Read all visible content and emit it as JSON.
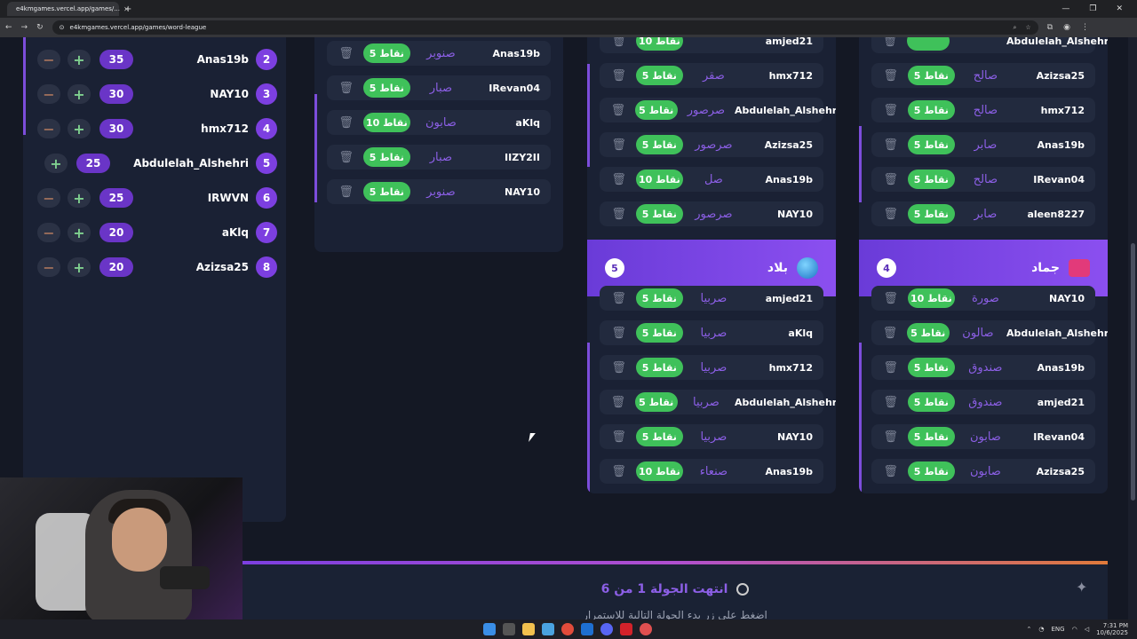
{
  "browser": {
    "tab_title": "e4kmgames.vercel.app/games/...",
    "url": "e4kmgames.vercel.app/games/word-league",
    "win_min": "—",
    "win_max": "❐",
    "win_close": "✕"
  },
  "leaderboard": [
    {
      "rank": "2",
      "name": "Anas19b",
      "score": "35"
    },
    {
      "rank": "3",
      "name": "NAY10",
      "score": "30"
    },
    {
      "rank": "4",
      "name": "hmx712",
      "score": "30"
    },
    {
      "rank": "5",
      "name": "Abdulelah_Alshehri",
      "score": "25"
    },
    {
      "rank": "6",
      "name": "IRWVN",
      "score": "25"
    },
    {
      "rank": "7",
      "name": "aKlq",
      "score": "20"
    },
    {
      "rank": "8",
      "name": "Azizsa25",
      "score": "20"
    }
  ],
  "cards": {
    "col1": [
      {
        "player": "Anas19b",
        "word": "صنوبر",
        "points": "5 نقاط"
      },
      {
        "player": "IRevan04",
        "word": "صبار",
        "points": "5 نقاط"
      },
      {
        "player": "aKlq",
        "word": "صابون",
        "points": "10 نقاط"
      },
      {
        "player": "IIZY2II",
        "word": "صبار",
        "points": "5 نقاط"
      },
      {
        "player": "NAY10",
        "word": "صنوبر",
        "points": "5 نقاط"
      }
    ],
    "col2": [
      {
        "player": "amjed21",
        "word": "",
        "points": "10 نقاط"
      },
      {
        "player": "hmx712",
        "word": "صقر",
        "points": "5 نقاط"
      },
      {
        "player": "Abdulelah_Alshehri",
        "word": "صرصور",
        "points": "5 نقاط"
      },
      {
        "player": "Azizsa25",
        "word": "صرصور",
        "points": "5 نقاط"
      },
      {
        "player": "Anas19b",
        "word": "صل",
        "points": "10 نقاط"
      },
      {
        "player": "NAY10",
        "word": "صرصور",
        "points": "5 نقاط"
      }
    ],
    "col3": [
      {
        "player": "Abdulelah_Alshehri",
        "word": "",
        "points": ""
      },
      {
        "player": "Azizsa25",
        "word": "صالح",
        "points": "5 نقاط"
      },
      {
        "player": "hmx712",
        "word": "صالح",
        "points": "5 نقاط"
      },
      {
        "player": "Anas19b",
        "word": "صابر",
        "points": "5 نقاط"
      },
      {
        "player": "IRevan04",
        "word": "صالح",
        "points": "5 نقاط"
      },
      {
        "player": "aleen8227",
        "word": "صابر",
        "points": "5 نقاط"
      }
    ],
    "countries": {
      "title": "بلاد",
      "count": "5",
      "entries": [
        {
          "player": "amjed21",
          "word": "صربيا",
          "points": "5 نقاط"
        },
        {
          "player": "aKlq",
          "word": "صربيا",
          "points": "5 نقاط"
        },
        {
          "player": "hmx712",
          "word": "صربيا",
          "points": "5 نقاط"
        },
        {
          "player": "Abdulelah_Alshehri",
          "word": "صربيا",
          "points": "5 نقاط"
        },
        {
          "player": "NAY10",
          "word": "صربيا",
          "points": "5 نقاط"
        },
        {
          "player": "Anas19b",
          "word": "صنعاء",
          "points": "10 نقاط"
        }
      ]
    },
    "objects": {
      "title": "جماد",
      "count": "4",
      "entries": [
        {
          "player": "NAY10",
          "word": "صورة",
          "points": "10 نقاط"
        },
        {
          "player": "Abdulelah_Alshehri",
          "word": "صالون",
          "points": "5 نقاط"
        },
        {
          "player": "Anas19b",
          "word": "صندوق",
          "points": "5 نقاط"
        },
        {
          "player": "amjed21",
          "word": "صندوق",
          "points": "5 نقاط"
        },
        {
          "player": "IRevan04",
          "word": "صابون",
          "points": "5 نقاط"
        },
        {
          "player": "Azizsa25",
          "word": "صابون",
          "points": "5 نقاط"
        }
      ]
    }
  },
  "banner": {
    "title": "انتهت الجولة 1 من 6",
    "subtitle": "اضغط على زر بدء الجولة التالية للاستمرار"
  },
  "taskbar": {
    "lang": "ENG",
    "time": "7:31 PM",
    "date": "10/6/2025"
  },
  "colors": {
    "accent": "#7c3fe0",
    "points_green": "#3fc15a",
    "card_bg": "#1a2134"
  }
}
